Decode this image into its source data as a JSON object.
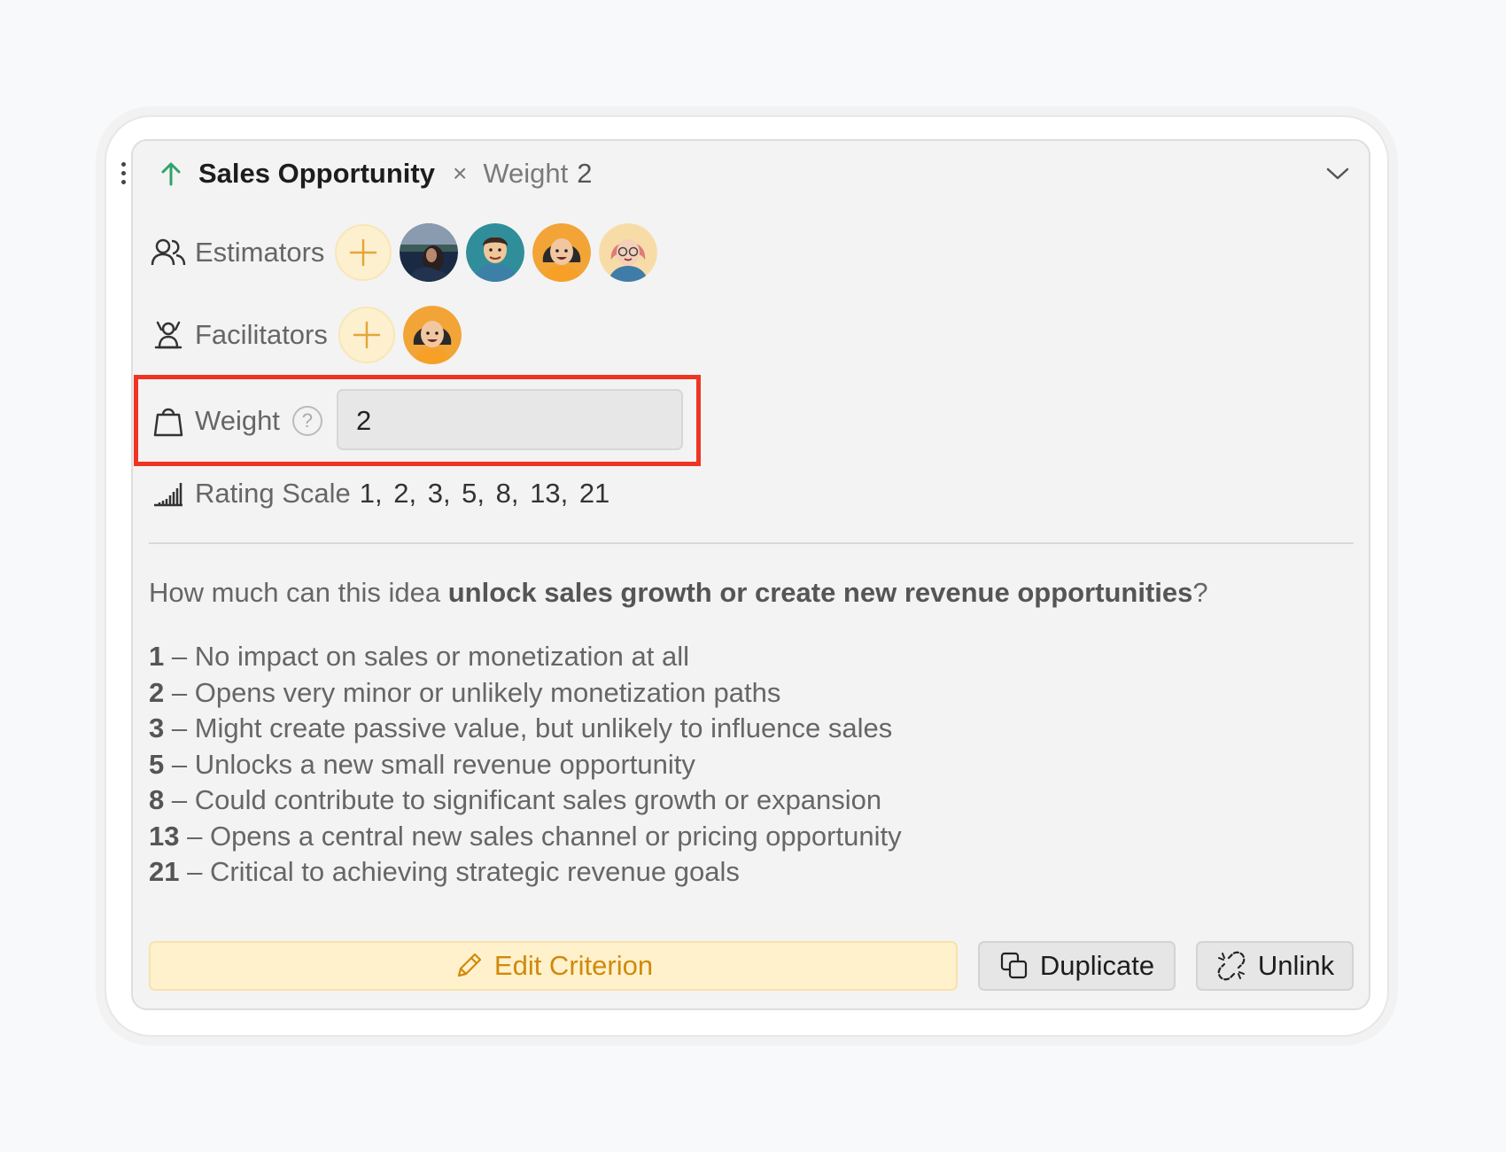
{
  "criterion": {
    "title": "Sales Opportunity",
    "separator": "×",
    "weight_label": "Weight",
    "weight_value": "2"
  },
  "estimators": {
    "label": "Estimators",
    "avatars": [
      "avatar-photo",
      "avatar-man-teal",
      "avatar-woman-orange",
      "avatar-woman-glasses"
    ]
  },
  "facilitators": {
    "label": "Facilitators",
    "avatars": [
      "avatar-woman-orange"
    ]
  },
  "weight_field": {
    "label": "Weight",
    "help": "?",
    "value": "2"
  },
  "rating_scale": {
    "label": "Rating Scale",
    "values": "1, 2, 3, 5, 8, 13, 21"
  },
  "description": {
    "question_prefix": "How much can this idea ",
    "question_bold": "unlock sales growth or create new revenue opportunities",
    "question_suffix": "?",
    "levels": [
      {
        "score": "1",
        "text": " – No impact on sales or monetization at all"
      },
      {
        "score": "2",
        "text": " – Opens very minor or unlikely monetization paths"
      },
      {
        "score": "3",
        "text": " – Might create passive value, but unlikely to influence sales"
      },
      {
        "score": "5",
        "text": " – Unlocks a new small revenue opportunity"
      },
      {
        "score": "8",
        "text": " – Could contribute to significant sales growth or expansion"
      },
      {
        "score": "13",
        "text": " – Opens a central new sales channel or pricing opportunity"
      },
      {
        "score": "21",
        "text": " – Critical to achieving strategic revenue goals"
      }
    ]
  },
  "actions": {
    "edit_label": "Edit Criterion",
    "duplicate_label": "Duplicate",
    "unlink_label": "Unlink"
  },
  "colors": {
    "accent_green": "#2fa36b",
    "highlight_red": "#ee3523",
    "edit_orange": "#d08a0b"
  }
}
